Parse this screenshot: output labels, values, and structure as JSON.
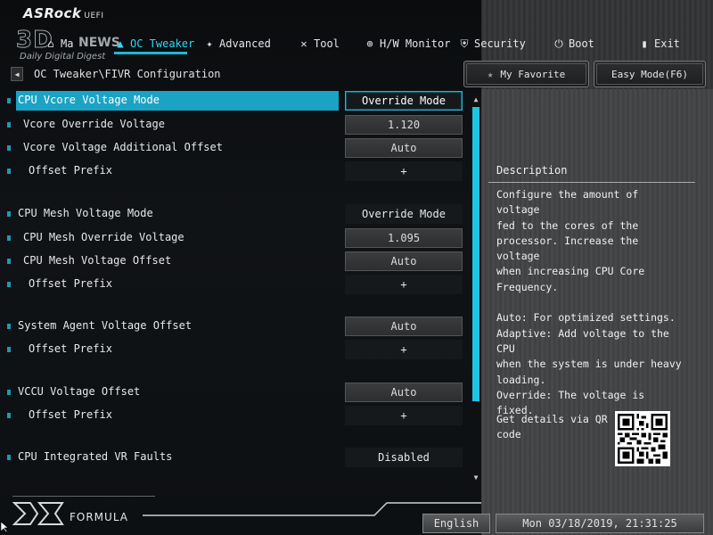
{
  "header": {
    "brand": "ASRock",
    "brand_suffix": "UEFI",
    "watermark_big": "3D",
    "watermark_news": "NEWS",
    "watermark_sub": "Daily Digital Digest"
  },
  "nav": {
    "items": [
      {
        "label": "Ma",
        "icon": "home-icon"
      },
      {
        "label": "OC Tweaker",
        "icon": "rocket-icon",
        "active": true
      },
      {
        "label": "Advanced",
        "icon": "star-icon"
      },
      {
        "label": "Tool",
        "icon": "tools-icon"
      },
      {
        "label": "H/W Monitor",
        "icon": "monitor-icon"
      },
      {
        "label": "Security",
        "icon": "shield-icon"
      },
      {
        "label": "Boot",
        "icon": "power-icon"
      },
      {
        "label": "Exit",
        "icon": "exit-icon"
      }
    ]
  },
  "breadcrumb": "OC Tweaker\\FIVR Configuration",
  "buttons": {
    "favorite": "My Favorite",
    "easy_mode": "Easy Mode(F6)"
  },
  "settings": [
    {
      "label": "CPU Vcore Voltage Mode",
      "value": "Override Mode",
      "selected": true
    },
    {
      "label": "Vcore Override Voltage",
      "value": "1.120"
    },
    {
      "label": "Vcore Voltage Additional Offset",
      "value": "Auto"
    },
    {
      "label": "Offset Prefix",
      "value": "+"
    },
    {
      "label": "CPU Mesh Voltage Mode",
      "value": "Override Mode"
    },
    {
      "label": "CPU Mesh Override Voltage",
      "value": "1.095"
    },
    {
      "label": "CPU Mesh Voltage Offset",
      "value": "Auto"
    },
    {
      "label": "Offset Prefix",
      "value": "+"
    },
    {
      "label": "System Agent Voltage Offset",
      "value": "Auto"
    },
    {
      "label": "Offset Prefix",
      "value": "+"
    },
    {
      "label": "VCCU Voltage Offset",
      "value": "Auto"
    },
    {
      "label": "Offset Prefix",
      "value": "+"
    },
    {
      "label": "CPU Integrated VR Faults",
      "value": "Disabled"
    }
  ],
  "description": {
    "title": "Description",
    "text": "Configure the amount of voltage\nfed to the cores of the\nprocessor. Increase the voltage\nwhen increasing CPU Core\nFrequency.\n\nAuto: For optimized settings.\nAdaptive: Add voltage to the CPU\nwhen the system is under heavy\nloading.\nOverride: The voltage is fixed.",
    "qr_text": "Get details via QR code"
  },
  "footer": {
    "brand": "FORMULA",
    "language": "English",
    "datetime": "Mon 03/18/2019, 21:31:25"
  },
  "colors": {
    "accent": "#1fb7d6",
    "selected_row": "#1aa3c4"
  }
}
